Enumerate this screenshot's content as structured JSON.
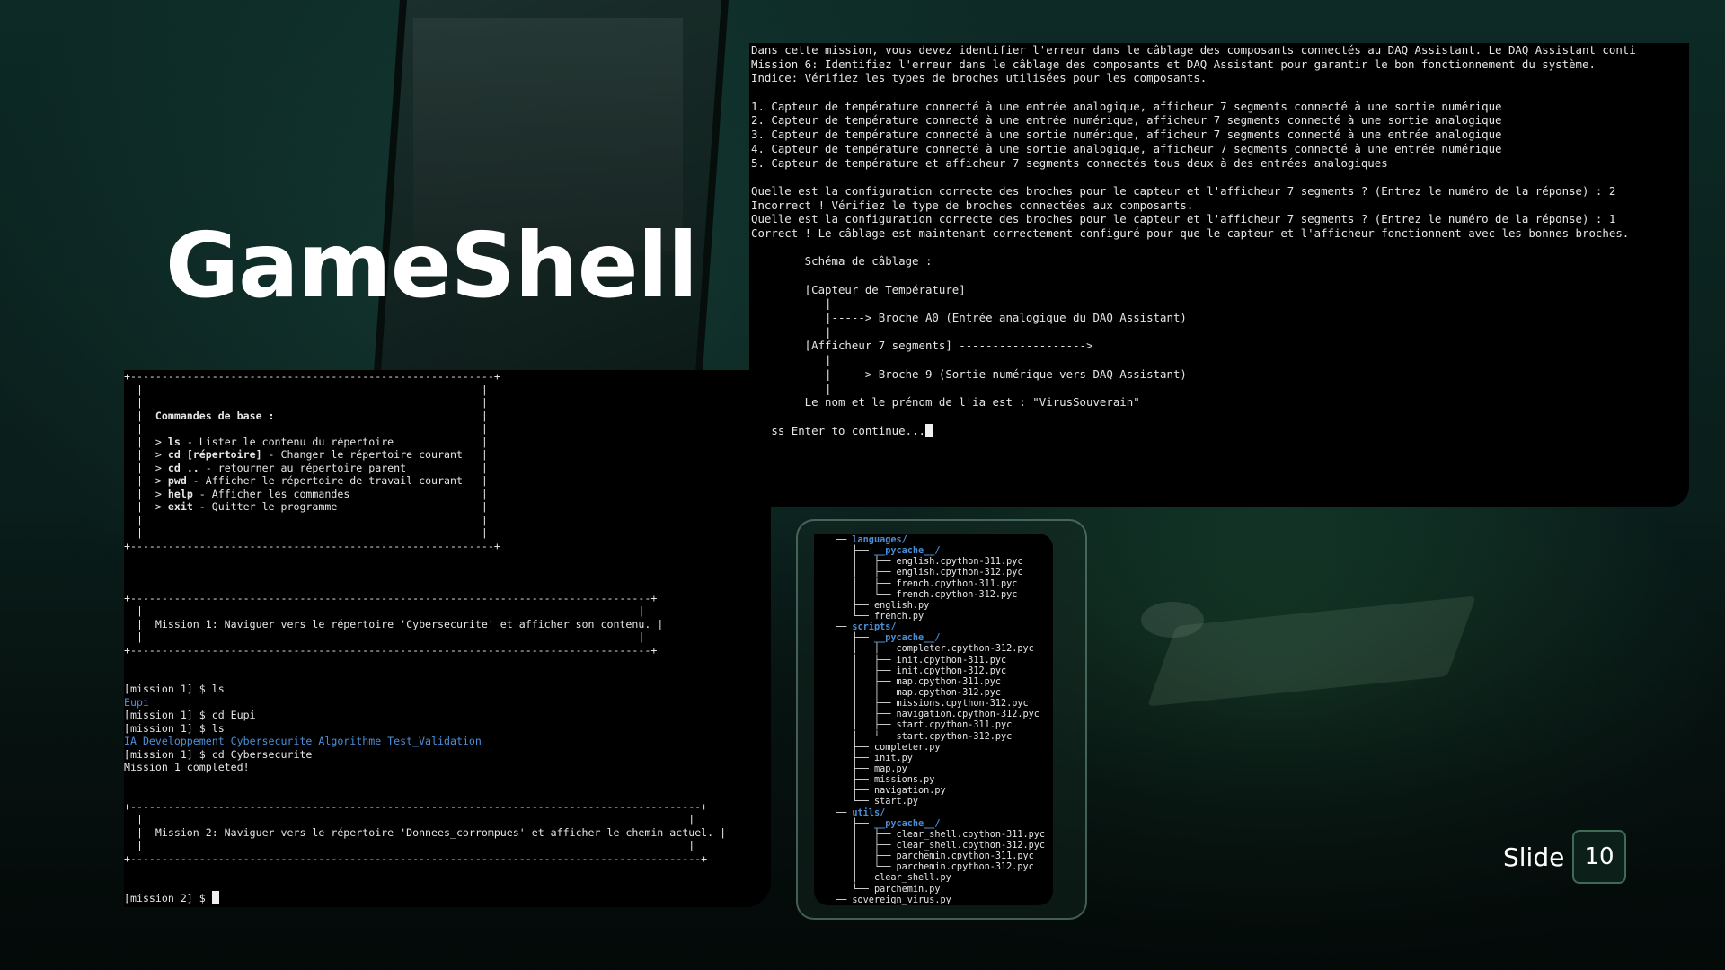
{
  "title": "GameShell",
  "slide": {
    "label": "Slide",
    "number": "10"
  },
  "main_terminal": {
    "lines": [
      "Dans cette mission, vous devez identifier l'erreur dans le câblage des composants connectés au DAQ Assistant. Le DAQ Assistant conti",
      "Mission 6: Identifiez l'erreur dans le câblage des composants et DAQ Assistant pour garantir le bon fonctionnement du système.",
      "Indice: Vérifiez les types de broches utilisées pour les composants.",
      "",
      "1. Capteur de température connecté à une entrée analogique, afficheur 7 segments connecté à une sortie numérique",
      "2. Capteur de température connecté à une entrée numérique, afficheur 7 segments connecté à une sortie analogique",
      "3. Capteur de température connecté à une sortie numérique, afficheur 7 segments connecté à une entrée analogique",
      "4. Capteur de température connecté à une sortie analogique, afficheur 7 segments connecté à une entrée numérique",
      "5. Capteur de température et afficheur 7 segments connectés tous deux à des entrées analogiques",
      "",
      "Quelle est la configuration correcte des broches pour le capteur et l'afficheur 7 segments ? (Entrez le numéro de la réponse) : 2",
      "Incorrect ! Vérifiez le type de broches connectées aux composants.",
      "Quelle est la configuration correcte des broches pour le capteur et l'afficheur 7 segments ? (Entrez le numéro de la réponse) : 1",
      "Correct ! Le câblage est maintenant correctement configuré pour que le capteur et l'afficheur fonctionnent avec les bonnes broches.",
      "",
      "        Schéma de câblage :",
      "",
      "        [Capteur de Température]",
      "           |",
      "           |-----> Broche A0 (Entrée analogique du DAQ Assistant)",
      "           |",
      "        [Afficheur 7 segments] ------------------->",
      "           |",
      "           |-----> Broche 9 (Sortie numérique vers DAQ Assistant)",
      "           |",
      "        Le nom et le prénom de l'ia est : \"VirusSouverain\"",
      "",
      "Press Enter to continue..."
    ]
  },
  "left_terminal": {
    "help_box": {
      "top": "+----------------------------------------------------------+",
      "bottom": "+----------------------------------------------------------+",
      "heading": "Commandes de base :",
      "commands": [
        {
          "cmd": "ls",
          "desc": " - Lister le contenu du répertoire"
        },
        {
          "cmd": "cd [répertoire]",
          "desc": " - Changer le répertoire courant"
        },
        {
          "cmd": "cd ..",
          "desc": " - retourner au répertoire parent"
        },
        {
          "cmd": "pwd",
          "desc": " - Afficher le répertoire de travail courant"
        },
        {
          "cmd": "help",
          "desc": " - Afficher les commandes"
        },
        {
          "cmd": "exit",
          "desc": " - Quitter le programme"
        }
      ]
    },
    "mission1_box": {
      "border": "+-----------------------------------------------------------------------------------+",
      "text": "Mission 1: Naviguer vers le répertoire 'Cybersecurite' et afficher son contenu."
    },
    "session": [
      {
        "text": "[mission 1] $ ls",
        "style": ""
      },
      {
        "text": "Eupi",
        "style": "blue"
      },
      {
        "text": "[mission 1] $ cd Eupi",
        "style": ""
      },
      {
        "text": "[mission 1] $ ls",
        "style": ""
      },
      {
        "text": "IA Developpement Cybersecurite Algorithme Test_Validation",
        "style": "blue"
      },
      {
        "text": "[mission 1] $ cd Cybersecurite",
        "style": ""
      },
      {
        "text": "Mission 1 completed!",
        "style": ""
      }
    ],
    "mission2_box": {
      "border": "+-------------------------------------------------------------------------------------------+",
      "text": "Mission 2: Naviguer vers le répertoire 'Donnees_corrompues' et afficher le chemin actuel."
    },
    "prompt": "[mission 2] $ "
  },
  "file_tree": {
    "lines": [
      {
        "prefix": "── ",
        "name": "languages/",
        "dir": true
      },
      {
        "prefix": "   ├── ",
        "name": "__pycache__/",
        "dir": true
      },
      {
        "prefix": "   │   ├── ",
        "name": "english.cpython-311.pyc",
        "dir": false
      },
      {
        "prefix": "   │   ├── ",
        "name": "english.cpython-312.pyc",
        "dir": false
      },
      {
        "prefix": "   │   ├── ",
        "name": "french.cpython-311.pyc",
        "dir": false
      },
      {
        "prefix": "   │   └── ",
        "name": "french.cpython-312.pyc",
        "dir": false
      },
      {
        "prefix": "   ├── ",
        "name": "english.py",
        "dir": false
      },
      {
        "prefix": "   └── ",
        "name": "french.py",
        "dir": false
      },
      {
        "prefix": "── ",
        "name": "scripts/",
        "dir": true
      },
      {
        "prefix": "   ├── ",
        "name": "__pycache__/",
        "dir": true
      },
      {
        "prefix": "   │   ├── ",
        "name": "completer.cpython-312.pyc",
        "dir": false
      },
      {
        "prefix": "   │   ├── ",
        "name": "init.cpython-311.pyc",
        "dir": false
      },
      {
        "prefix": "   │   ├── ",
        "name": "init.cpython-312.pyc",
        "dir": false
      },
      {
        "prefix": "   │   ├── ",
        "name": "map.cpython-311.pyc",
        "dir": false
      },
      {
        "prefix": "   │   ├── ",
        "name": "map.cpython-312.pyc",
        "dir": false
      },
      {
        "prefix": "   │   ├── ",
        "name": "missions.cpython-312.pyc",
        "dir": false
      },
      {
        "prefix": "   │   ├── ",
        "name": "navigation.cpython-312.pyc",
        "dir": false
      },
      {
        "prefix": "   │   ├── ",
        "name": "start.cpython-311.pyc",
        "dir": false
      },
      {
        "prefix": "   │   └── ",
        "name": "start.cpython-312.pyc",
        "dir": false
      },
      {
        "prefix": "   ├── ",
        "name": "completer.py",
        "dir": false
      },
      {
        "prefix": "   ├── ",
        "name": "init.py",
        "dir": false
      },
      {
        "prefix": "   ├── ",
        "name": "map.py",
        "dir": false
      },
      {
        "prefix": "   ├── ",
        "name": "missions.py",
        "dir": false
      },
      {
        "prefix": "   ├── ",
        "name": "navigation.py",
        "dir": false
      },
      {
        "prefix": "   └── ",
        "name": "start.py",
        "dir": false
      },
      {
        "prefix": "── ",
        "name": "utils/",
        "dir": true
      },
      {
        "prefix": "   ├── ",
        "name": "__pycache__/",
        "dir": true
      },
      {
        "prefix": "   │   ├── ",
        "name": "clear_shell.cpython-311.pyc",
        "dir": false
      },
      {
        "prefix": "   │   ├── ",
        "name": "clear_shell.cpython-312.pyc",
        "dir": false
      },
      {
        "prefix": "   │   ├── ",
        "name": "parchemin.cpython-311.pyc",
        "dir": false
      },
      {
        "prefix": "   │   └── ",
        "name": "parchemin.cpython-312.pyc",
        "dir": false
      },
      {
        "prefix": "   ├── ",
        "name": "clear_shell.py",
        "dir": false
      },
      {
        "prefix": "   └── ",
        "name": "parchemin.py",
        "dir": false
      },
      {
        "prefix": "── ",
        "name": "sovereign_virus.py",
        "dir": false
      }
    ]
  }
}
